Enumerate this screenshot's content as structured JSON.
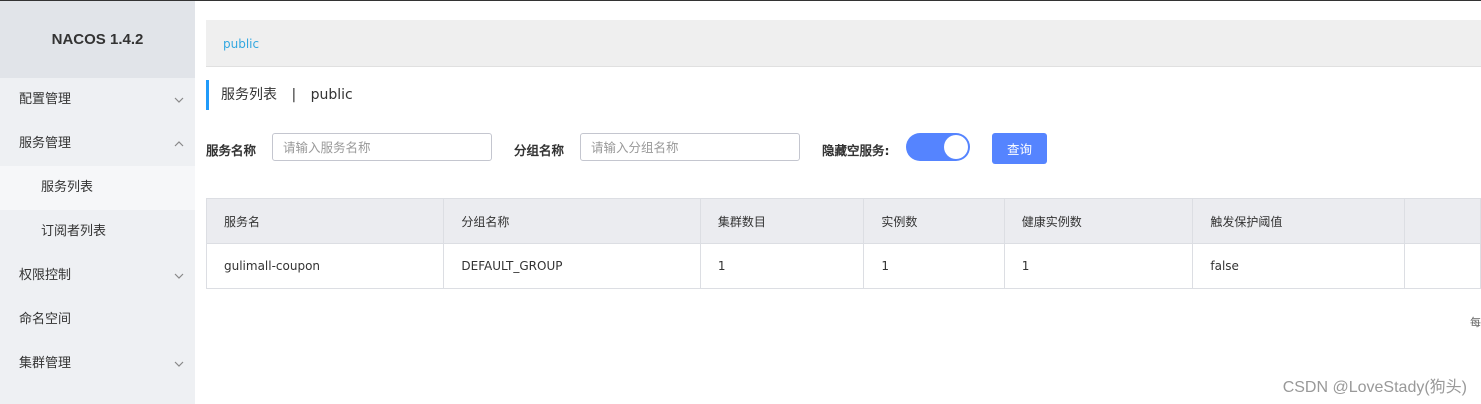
{
  "app": {
    "title": "NACOS 1.4.2"
  },
  "sidebar": {
    "items": [
      {
        "label": "配置管理",
        "chevron": "down"
      },
      {
        "label": "服务管理",
        "chevron": "up"
      },
      {
        "label": "服务列表",
        "sub": true,
        "active": true
      },
      {
        "label": "订阅者列表",
        "sub": true
      },
      {
        "label": "权限控制",
        "chevron": "down"
      },
      {
        "label": "命名空间"
      },
      {
        "label": "集群管理",
        "chevron": "down"
      }
    ]
  },
  "namespace_bar": {
    "current": "public"
  },
  "page": {
    "title": "服务列表",
    "separator": "|",
    "namespace": "public"
  },
  "filters": {
    "service_name_label": "服务名称",
    "service_name_placeholder": "请输入服务名称",
    "group_name_label": "分组名称",
    "group_name_placeholder": "请输入分组名称",
    "hide_empty_label": "隐藏空服务:",
    "hide_empty_enabled": true,
    "query_button": "查询"
  },
  "table": {
    "columns": [
      "服务名",
      "分组名称",
      "集群数目",
      "实例数",
      "健康实例数",
      "触发保护阈值",
      ""
    ],
    "rows": [
      [
        "gulimall-coupon",
        "DEFAULT_GROUP",
        "1",
        "1",
        "1",
        "false",
        ""
      ]
    ]
  },
  "pagination": {
    "partial_text": "每"
  },
  "watermark": "CSDN @LoveStady(狗头)",
  "colors": {
    "accent": "#5584ff",
    "link": "#33a8e0",
    "title_bar": "#209bfa"
  }
}
